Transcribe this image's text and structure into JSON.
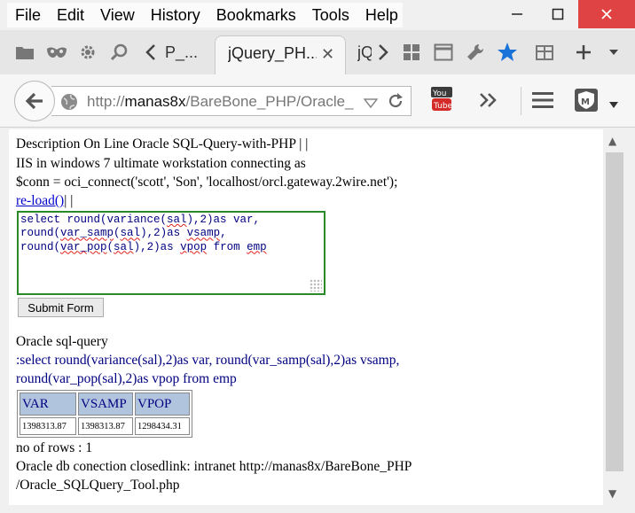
{
  "menu": [
    "File",
    "Edit",
    "View",
    "History",
    "Bookmarks",
    "Tools",
    "Help"
  ],
  "tabs": {
    "left_partial": "P_...",
    "active": "jQuery_PH...",
    "right_partial": "jQ"
  },
  "nav": {
    "url_prefix": "http://",
    "url_host": "manas8x",
    "url_path": "/BareBone_PHP/Oracle_"
  },
  "page": {
    "desc_line1": "Description On Line Oracle SQL-Query-with-PHP | |",
    "desc_line2": "IIS in windows 7 ultimate workstation connecting as",
    "desc_line3": "$conn = oci_connect('scott', 'Son', 'localhost/orcl.gateway.2wire.net');",
    "reload_link": "re-load()",
    "reload_sep": "| |",
    "sql_lines": [
      "select round(variance(sal),2)as var,",
      "round(var_samp(sal),2)as vsamp,",
      "round(var_pop(sal),2)as vpop from emp"
    ],
    "submit_label": "Submit Form",
    "query_heading": "Oracle sql-query",
    "query_line1": ":select round(variance(sal),2)as var, round(var_samp(sal),2)as vsamp,",
    "query_line2": "round(var_pop(sal),2)as vpop from emp",
    "table": {
      "headers": [
        "VAR",
        "VSAMP",
        "VPOP"
      ],
      "rows": [
        [
          "1398313.87",
          "1398313.87",
          "1298434.31"
        ]
      ]
    },
    "rows_count": "no of rows : 1",
    "closed_line1": "Oracle db conection closedlink: intranet http://manas8x/BareBone_PHP",
    "closed_line2": "/Oracle_SQLQuery_Tool.php"
  },
  "colors": {
    "accent_blue": "#000080",
    "table_header": "#b0c4de",
    "textarea_border": "#2a8a2a",
    "close_button": "#e04343"
  },
  "icons": [
    "folder-icon",
    "mask-icon",
    "gear-icon",
    "search-icon",
    "chevron-left-icon",
    "chevron-right-icon",
    "apps-grid-icon",
    "window-icon",
    "wrench-icon",
    "star-icon",
    "clipboard-icon",
    "plus-icon",
    "chevron-down-icon",
    "back-arrow-icon",
    "globe-icon",
    "dropdown-arrow-icon",
    "reload-icon",
    "youtube-icon",
    "double-chevron-icon",
    "hamburger-menu-icon",
    "shield-icon"
  ]
}
